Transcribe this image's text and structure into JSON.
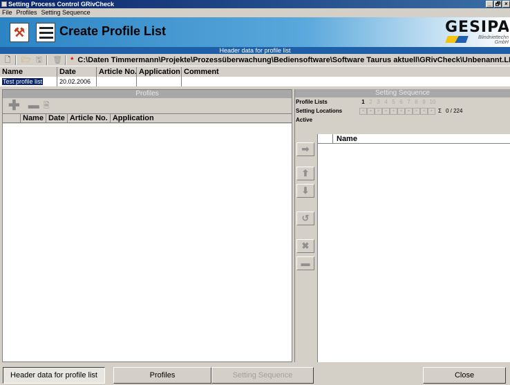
{
  "window": {
    "title": "Setting Process Control GRivCheck",
    "controls": [
      "_",
      "🗗",
      "×"
    ]
  },
  "menu": [
    "File",
    "Profiles",
    "Setting Sequence"
  ],
  "banner": {
    "title": "Create Profile List",
    "logo_text": "GESIPA",
    "logo_sub1": "Blindniettechn",
    "logo_sub2": "GmbH"
  },
  "section_title": "Header data for profile list",
  "toolbar": {
    "modified_marker": "*",
    "file_path": "C:\\Daten Timmermann\\Projekte\\Prozessüberwachung\\Bediensoftware\\Software Taurus aktuell\\GRivCheck\\Unbenannt.LIS"
  },
  "header_table": {
    "columns": [
      "Name",
      "Date",
      "Article No.",
      "Application",
      "Comment"
    ],
    "values": [
      "Test profile list",
      "20.02.2006",
      "",
      "",
      ""
    ]
  },
  "profiles_pane": {
    "title": "Profiles",
    "columns": [
      "Name",
      "Date",
      "Article No.",
      "Application"
    ]
  },
  "setting_sequence_pane": {
    "title": "Setting Sequence",
    "profile_lists_label": "Profile Lists",
    "profile_list_numbers": [
      "1",
      "2",
      "3",
      "4",
      "5",
      "6",
      "7",
      "8",
      "9",
      "10"
    ],
    "active_profile_list": "1",
    "setting_locations_label": "Setting Locations",
    "slot_marker": "-",
    "sigma": "Σ",
    "count": "0 / 224",
    "active_label": "Active",
    "list_column": "Name"
  },
  "bottom_buttons": {
    "header": "Header data for profile list",
    "profiles": "Profiles",
    "setting_sequence": "Setting Sequence",
    "close": "Close"
  }
}
